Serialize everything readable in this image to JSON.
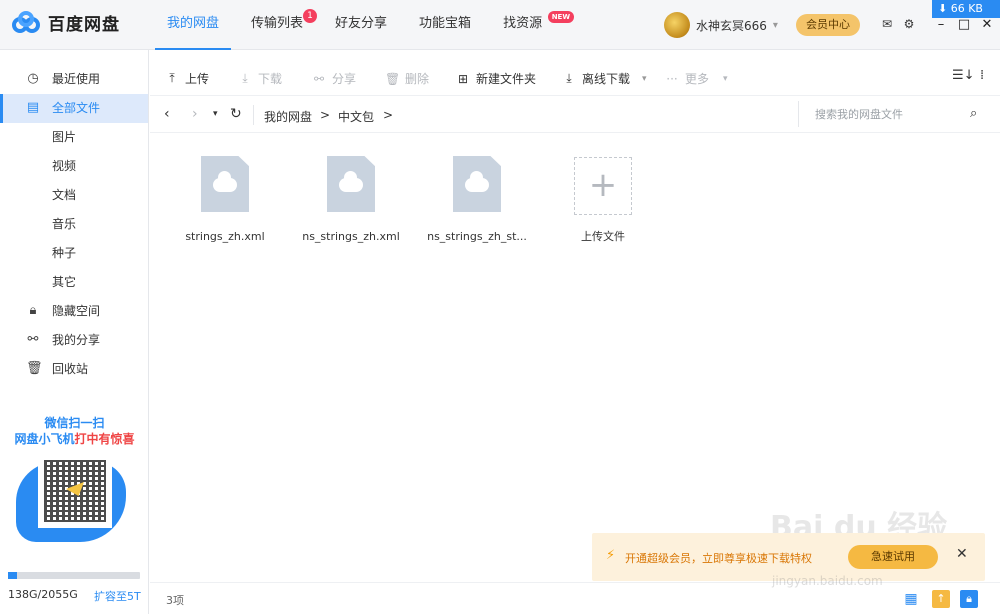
{
  "app": {
    "logo_text": "百度网盘",
    "speed": "⬇ 66 KB"
  },
  "nav": [
    {
      "label": "我的网盘",
      "active": true
    },
    {
      "label": "传输列表",
      "badge": "1"
    },
    {
      "label": "好友分享"
    },
    {
      "label": "功能宝箱"
    },
    {
      "label": "找资源",
      "tag": "NEW"
    }
  ],
  "user": {
    "name": "水神玄冥666",
    "vip_button": "会员中心"
  },
  "sidebar": {
    "items": [
      {
        "label": "最近使用",
        "icon": "clock-icon"
      },
      {
        "label": "全部文件",
        "icon": "file-icon",
        "active": true
      },
      {
        "label": "图片"
      },
      {
        "label": "视频"
      },
      {
        "label": "文档"
      },
      {
        "label": "音乐"
      },
      {
        "label": "种子"
      },
      {
        "label": "其它"
      },
      {
        "label": "隐藏空间",
        "icon": "lock-icon"
      },
      {
        "label": "我的分享",
        "icon": "share-icon"
      },
      {
        "label": "回收站",
        "icon": "trash-icon"
      }
    ],
    "promo_line1": "微信扫一扫",
    "promo_line2_a": "网盘小飞机",
    "promo_line2_b": "打中有惊喜",
    "storage": {
      "used_fraction": 0.067,
      "text": "138G/2055G",
      "expand": "扩容至5T"
    }
  },
  "toolbar": {
    "upload": "上传",
    "download": "下载",
    "share": "分享",
    "delete": "删除",
    "new_folder": "新建文件夹",
    "offline": "离线下载",
    "more": "更多"
  },
  "path": {
    "root": "我的网盘",
    "sep": ">",
    "folder": "中文包",
    "search_placeholder": "搜索我的网盘文件"
  },
  "files": [
    {
      "name": "strings_zh.xml"
    },
    {
      "name": "ns_strings_zh.xml"
    },
    {
      "name": "ns_strings_zh_st..."
    }
  ],
  "upload_tile": {
    "label": "上传文件"
  },
  "notice": {
    "text": "开通超级会员，立即尊享极速下载特权",
    "button": "急速试用"
  },
  "status": {
    "count": "3项"
  },
  "watermark": {
    "brand": "Bai du 经验",
    "url": "jingyan.baidu.com"
  }
}
